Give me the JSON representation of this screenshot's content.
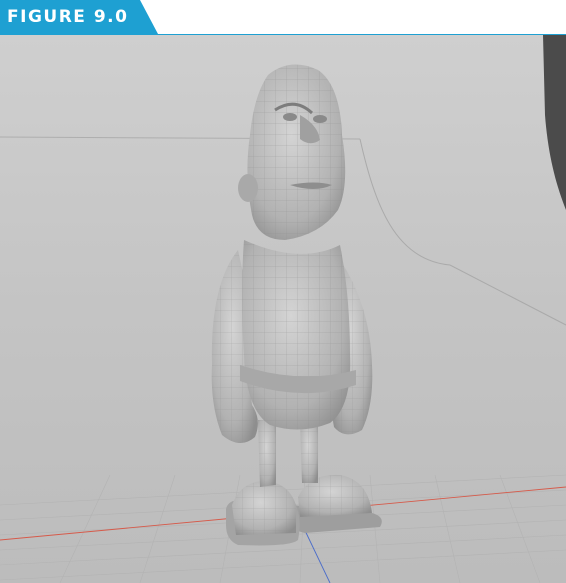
{
  "figure": {
    "label": "FIGURE 9.0",
    "tab_color": "#1ea0d2"
  },
  "viewport": {
    "background_color": "#c2c2c2",
    "model_color": "#b8b8b8",
    "grid_color": "#b3b3b3",
    "x_axis_color": "#d65a4a",
    "z_axis_color": "#4a6cc9"
  }
}
